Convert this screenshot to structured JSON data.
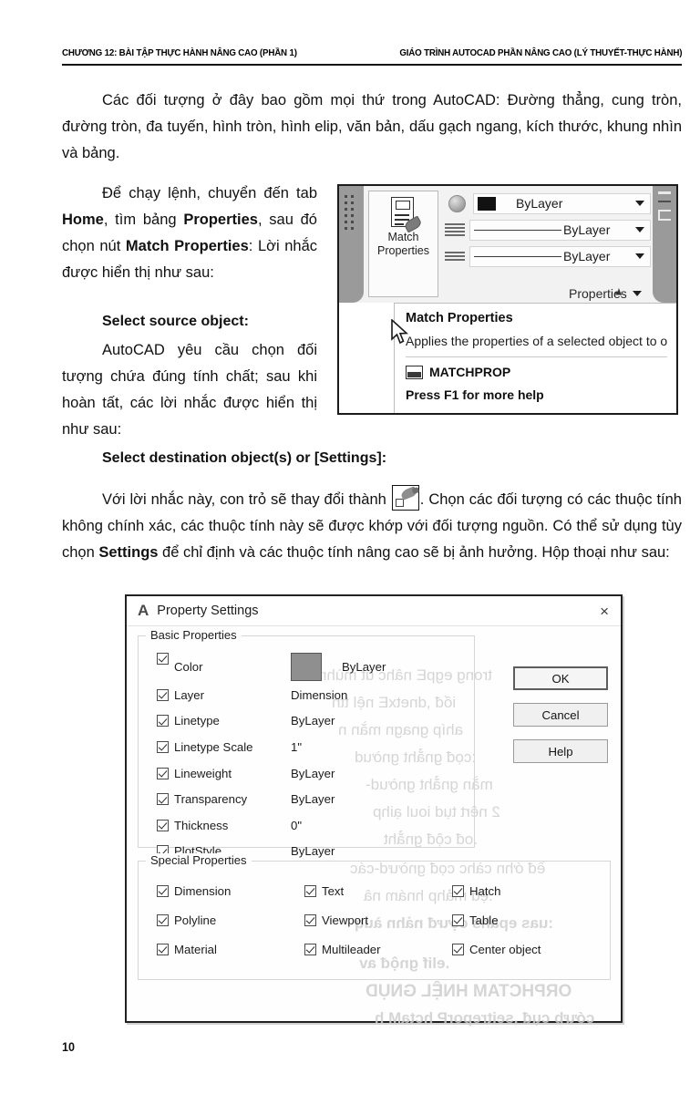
{
  "header": {
    "left": "CHƯƠNG 12: BÀI TẬP THỰC HÀNH NÂNG CAO (PHẦN 1)",
    "right": "GIÁO TRÌNH AUTOCAD PHẦN NÂNG CAO (LÝ THUYẾT-THỰC HÀNH)"
  },
  "paragraphs": {
    "p1": "Các đối tượng ở đây bao gồm mọi thứ trong AutoCAD: Đường thẳng, cung tròn, đường tròn, đa tuyến, hình tròn, hình elip, văn bản, dấu gạch ngang, kích thước, khung nhìn và bảng.",
    "p2_part1": "Để chạy lệnh, chuyển đến tab ",
    "p2_bold1": "Home",
    "p2_part2": ", tìm bảng ",
    "p2_bold2": "Properties",
    "p2_part3": ", sau đó chọn nút ",
    "p2_bold3": "Match Properties",
    "p2_part4": ": Lời nhắc được hiển thị như sau:",
    "prompt1": "Select source object:",
    "p3": "AutoCAD yêu cầu chọn đối tượng chứa đúng tính chất; sau khi hoàn tất, các lời nhắc được hiển thị như sau:",
    "prompt2": "Select destination object(s) or [Settings]:",
    "p4_part1": "Với lời nhắc này, con trỏ sẽ thay đổi thành ",
    "p4_part2": ". Chọn các đối tượng có các thuộc tính không chính xác, các thuộc tính này sẽ được khớp với đối tượng nguồn. Có thể sử dụng tùy chọn ",
    "p4_bold1": "Settings",
    "p4_part3": " để chỉ định và các thuộc tính nâng cao sẽ bị ảnh hưởng. Hộp thoại như sau:"
  },
  "ribbon": {
    "match_properties_button": {
      "line1": "Match",
      "line2": "Properties"
    },
    "fields": [
      {
        "icon": "color-sphere-icon",
        "swatch": "#121212",
        "value": "ByLayer"
      },
      {
        "icon": "linetype-lines-icon",
        "value": "ByLayer"
      },
      {
        "icon": "lineweight-lines-icon",
        "value": "ByLayer"
      }
    ],
    "panel_label": "Properties",
    "tooltip": {
      "title": "Match Properties",
      "description": "Applies the properties of a selected object to o",
      "command": "MATCHPROP",
      "help": "Press F1 for more help"
    }
  },
  "dialog": {
    "title": "Property Settings",
    "logo": "A",
    "close_icon": "×",
    "basic_group_legend": "Basic Properties",
    "basic_properties": [
      {
        "label": "Color",
        "value": "ByLayer",
        "checked": true,
        "swatch": "#8f8f8f",
        "sub_value": "Dimension"
      },
      {
        "label": "Layer",
        "value": "Dimension",
        "checked": true
      },
      {
        "label": "Linetype",
        "value": "ByLayer",
        "checked": true
      },
      {
        "label": "Linetype Scale",
        "value": "1\"",
        "checked": true
      },
      {
        "label": "Lineweight",
        "value": "ByLayer",
        "checked": true
      },
      {
        "label": "Transparency",
        "value": "ByLayer",
        "checked": true
      },
      {
        "label": "Thickness",
        "value": "0\"",
        "checked": true
      },
      {
        "label": "PlotStyle",
        "value": "ByLayer",
        "checked": true
      }
    ],
    "special_group_legend": "Special Properties",
    "special_properties": [
      {
        "label": "Dimension",
        "checked": true
      },
      {
        "label": "Text",
        "checked": true
      },
      {
        "label": "Hatch",
        "checked": true
      },
      {
        "label": "Polyline",
        "checked": true
      },
      {
        "label": "Viewport",
        "checked": true
      },
      {
        "label": "Table",
        "checked": true
      },
      {
        "label": "Material",
        "checked": true
      },
      {
        "label": "Multileader",
        "checked": true
      },
      {
        "label": "Center object",
        "checked": true
      }
    ],
    "buttons": [
      {
        "label": "OK",
        "default": true
      },
      {
        "label": "Cancel",
        "default": false
      },
      {
        "label": "Help",
        "default": false
      }
    ]
  },
  "page_number": "10"
}
